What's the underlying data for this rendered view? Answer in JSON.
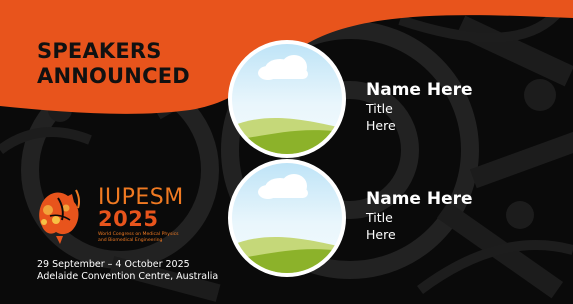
{
  "headline": {
    "line1": "SPEAKERS",
    "line2": "ANNOUNCED"
  },
  "speakers": [
    {
      "name": "Name Here",
      "title_line1": "Title",
      "title_line2": "Here"
    },
    {
      "name": "Name Here",
      "title_line1": "Title",
      "title_line2": "Here"
    }
  ],
  "logo": {
    "name": "IUPESM",
    "year": "2025",
    "subtitle_line1": "World Congress on Medical Physics",
    "subtitle_line2": "and Biomedical Engineering"
  },
  "event": {
    "dates": "29 September – 4 October 2025",
    "venue": "Adelaide Convention Centre, Australia"
  },
  "colors": {
    "orange": "#e8541c",
    "logo_orange": "#f07a22",
    "background": "#0a0a0a",
    "text_light": "#ffffff",
    "text_dark": "#111111"
  },
  "icons": {
    "placeholder": "landscape-placeholder-icon",
    "logo_mark": "australia-map-logo-icon",
    "background": "gear-pattern-icon"
  }
}
